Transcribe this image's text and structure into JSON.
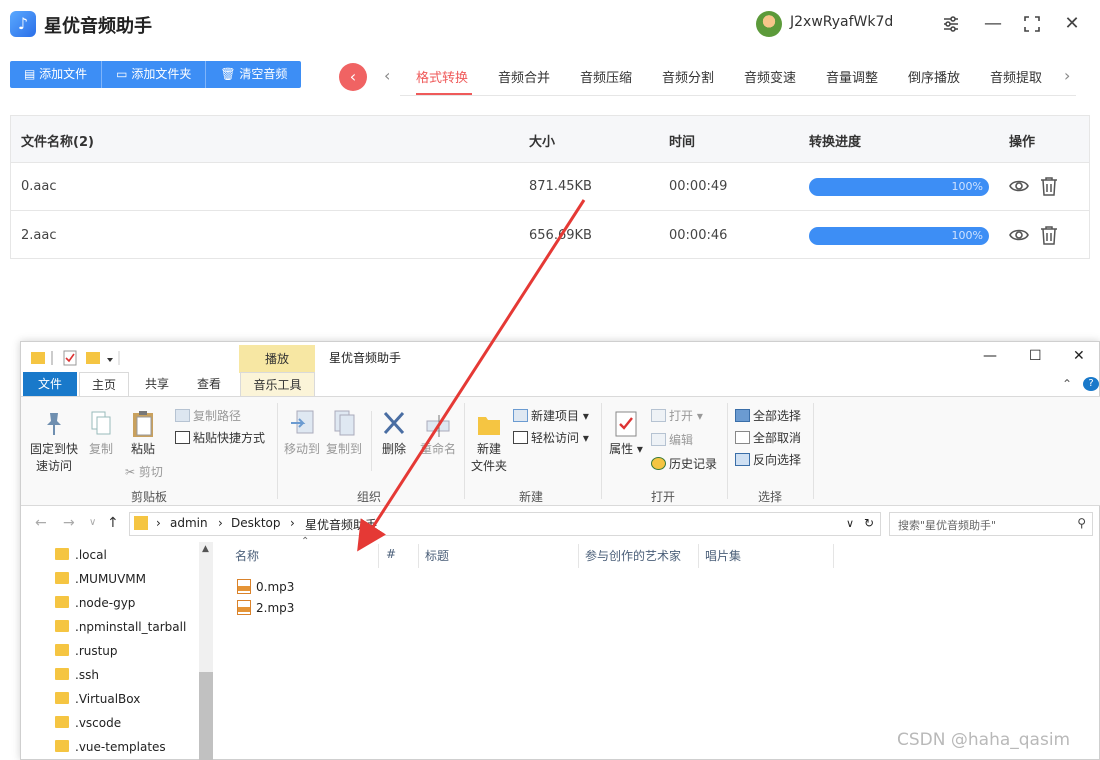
{
  "app": {
    "name": "星优音频助手",
    "username": "J2xwRyafWk7d"
  },
  "toolbar": {
    "add_file": "添加文件",
    "add_folder": "添加文件夹",
    "clear_audio": "清空音频"
  },
  "tabs": [
    "格式转换",
    "音频合并",
    "音频压缩",
    "音频分割",
    "音频变速",
    "音量调整",
    "倒序播放",
    "音频提取"
  ],
  "table": {
    "headers": {
      "name": "文件名称(2)",
      "size": "大小",
      "time": "时间",
      "progress": "转换进度",
      "action": "操作"
    },
    "rows": [
      {
        "name": "0.aac",
        "size": "871.45KB",
        "time": "00:00:49",
        "progress": "100%"
      },
      {
        "name": "2.aac",
        "size": "656.69KB",
        "time": "00:00:46",
        "progress": "100%"
      }
    ]
  },
  "explorer": {
    "title": "星优音频助手",
    "context_tab": "播放",
    "ribbon_tabs": {
      "file": "文件",
      "home": "主页",
      "share": "共享",
      "view": "查看",
      "music": "音乐工具"
    },
    "clipboard": {
      "pin": "固定到快\n速访问",
      "copy": "复制",
      "paste": "粘贴",
      "copy_path": "复制路径",
      "paste_shortcut": "粘贴快捷方式",
      "cut": "剪切",
      "label": "剪贴板"
    },
    "organize": {
      "move_to": "移动到",
      "copy_to": "复制到",
      "delete": "删除",
      "rename": "重命名",
      "label": "组织"
    },
    "new": {
      "new_folder": "新建\n文件夹",
      "new_item": "新建项目",
      "easy_access": "轻松访问",
      "label": "新建"
    },
    "open": {
      "properties": "属性",
      "open": "打开",
      "edit": "编辑",
      "history": "历史记录",
      "label": "打开"
    },
    "select": {
      "select_all": "全部选择",
      "select_none": "全部取消",
      "invert": "反向选择",
      "label": "选择"
    },
    "address": {
      "crumbs": [
        "admin",
        "Desktop",
        "星优音频助手"
      ],
      "search_placeholder": "搜索\"星优音频助手\""
    },
    "nav_items": [
      ".local",
      ".MUMUVMM",
      ".node-gyp",
      ".npminstall_tarball",
      ".rustup",
      ".ssh",
      ".VirtualBox",
      ".vscode",
      ".vue-templates"
    ],
    "columns": {
      "name": "名称",
      "num": "#",
      "title": "标题",
      "artist": "参与创作的艺术家",
      "album": "唱片集"
    },
    "files": [
      "0.mp3",
      "2.mp3"
    ]
  },
  "watermark": "CSDN @haha_qasim",
  "colors": {
    "accent": "#3d8ef5",
    "active_tab": "#ef5a5a",
    "arrow": "#e53935"
  }
}
